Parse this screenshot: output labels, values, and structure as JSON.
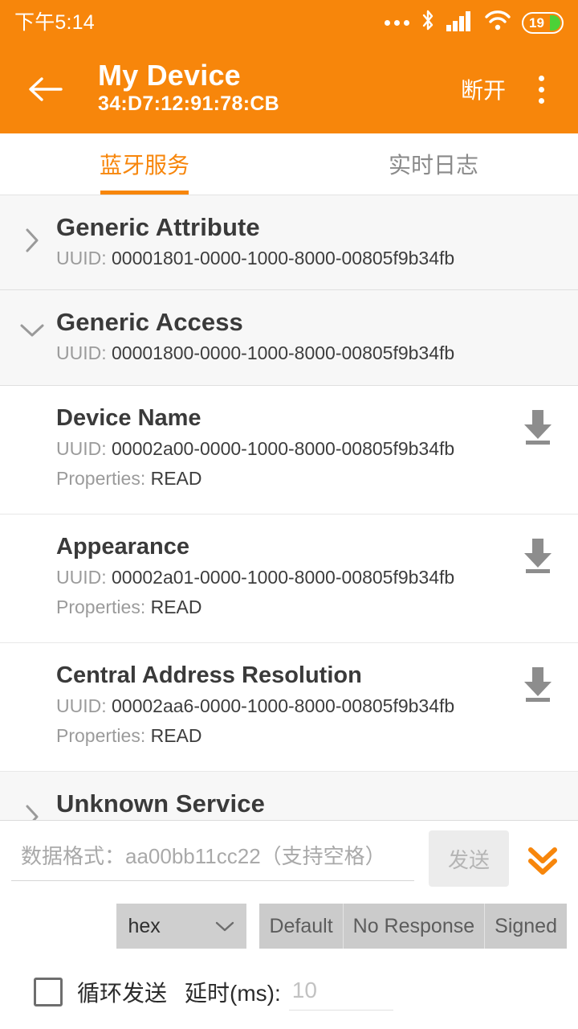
{
  "statusbar": {
    "clock": "下午5:14",
    "battery_level": "19",
    "icons": [
      "more-dots-icon",
      "bluetooth-icon",
      "signal-icon",
      "wifi-icon",
      "battery-icon"
    ]
  },
  "appbar": {
    "back_icon": "back-arrow-icon",
    "title": "My Device",
    "mac": "34:D7:12:91:78:CB",
    "action_label": "断开",
    "overflow_icon": "kebab-menu-icon"
  },
  "tabs": [
    {
      "label": "蓝牙服务",
      "active": true
    },
    {
      "label": "实时日志",
      "active": false
    }
  ],
  "list": [
    {
      "kind": "service",
      "name": "Generic Attribute",
      "uuid_label": "UUID:",
      "uuid": "00001801-0000-1000-8000-00805f9b34fb",
      "expanded": false,
      "chevron": "chevron-right-icon"
    },
    {
      "kind": "service",
      "name": "Generic Access",
      "uuid_label": "UUID:",
      "uuid": "00001800-0000-1000-8000-00805f9b34fb",
      "expanded": true,
      "chevron": "chevron-down-icon"
    },
    {
      "kind": "characteristic",
      "name": "Device Name",
      "uuid_label": "UUID:",
      "uuid": "00002a00-0000-1000-8000-00805f9b34fb",
      "props_label": "Properties:",
      "props": "READ",
      "action_icon": "download-read-icon"
    },
    {
      "kind": "characteristic",
      "name": "Appearance",
      "uuid_label": "UUID:",
      "uuid": "00002a01-0000-1000-8000-00805f9b34fb",
      "props_label": "Properties:",
      "props": "READ",
      "action_icon": "download-read-icon"
    },
    {
      "kind": "characteristic",
      "name": "Central Address Resolution",
      "uuid_label": "UUID:",
      "uuid": "00002aa6-0000-1000-8000-00805f9b34fb",
      "props_label": "Properties:",
      "props": "READ",
      "action_icon": "download-read-icon"
    },
    {
      "kind": "service",
      "name": "Unknown Service",
      "uuid_label": "",
      "uuid": "",
      "expanded": false,
      "chevron": "chevron-right-icon"
    }
  ],
  "bottom": {
    "data_placeholder": "数据格式：aa00bb11cc22（支持空格）",
    "data_value": "",
    "send_label": "发送",
    "collapse_icon": "double-chevron-down-icon",
    "format_select": {
      "value": "hex",
      "chevron": "chevron-down-icon"
    },
    "write_modes": [
      "Default",
      "No Response",
      "Signed"
    ],
    "loop": {
      "checked": false,
      "label": "循环发送",
      "delay_label": "延时(ms):",
      "delay_placeholder": "10",
      "delay_value": ""
    }
  },
  "colors": {
    "accent": "#F7860B",
    "appbar": "#F7860B",
    "battery_fill": "#4CD137",
    "service_bg": "#f7f7f7",
    "tab_inactive": "#8a8a8a"
  }
}
